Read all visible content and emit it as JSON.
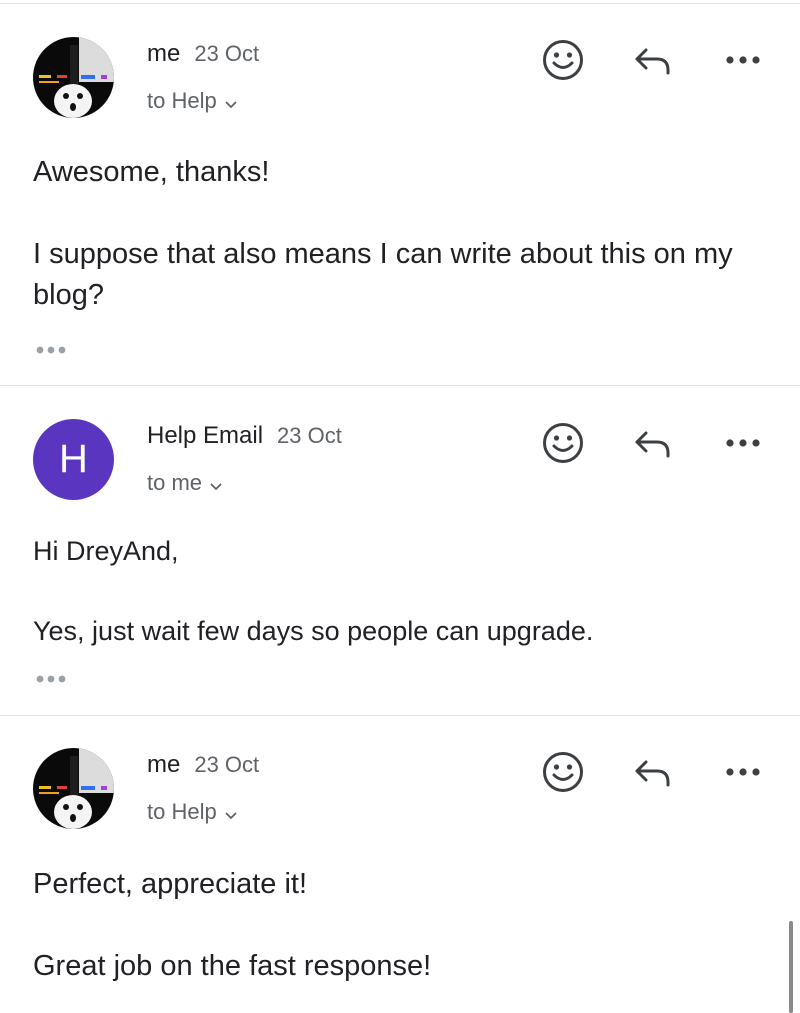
{
  "messages": [
    {
      "sender": "me",
      "date": "23 Oct",
      "recipient": "to Help",
      "body": "Awesome, thanks!\n\nI suppose that also means I can write about this on my blog?",
      "avatar": "profile-photo"
    },
    {
      "sender": "Help Email",
      "date": "23 Oct",
      "recipient": "to me",
      "body": "Hi DreyAnd,\n\nYes, just wait few days so people can upgrade.",
      "avatar_letter": "H",
      "avatar_color": "#5a35c0"
    },
    {
      "sender": "me",
      "date": "23 Oct",
      "recipient": "to Help",
      "body": "Perfect, appreciate it!\n\nGreat job on the fast response!",
      "avatar": "profile-photo"
    }
  ],
  "icons": {
    "emoji": "smiley-icon",
    "reply": "reply-arrow-icon",
    "more": "more-dots-icon",
    "trimmed": "trimmed-content-icon",
    "expand": "chevron-down-icon"
  },
  "colors": {
    "avatar_purple": "#5a35c0",
    "muted": "#5f6368",
    "text": "#202124"
  }
}
